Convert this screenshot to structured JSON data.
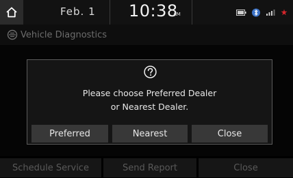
{
  "status": {
    "date": "Feb.  1",
    "time": "10:38",
    "ampm": "AM"
  },
  "header": {
    "title": "Vehicle Diagnostics"
  },
  "dialog": {
    "icon": "question-circle-icon",
    "message_line1": "Please choose Preferred Dealer",
    "message_line2": "or Nearest Dealer.",
    "buttons": [
      "Preferred",
      "Nearest",
      "Close"
    ]
  },
  "bottom_bar": {
    "buttons": [
      "Schedule Service",
      "Send Report",
      "Close"
    ]
  },
  "colors": {
    "accent_red": "#d8262c",
    "dim_text": "#595959"
  }
}
